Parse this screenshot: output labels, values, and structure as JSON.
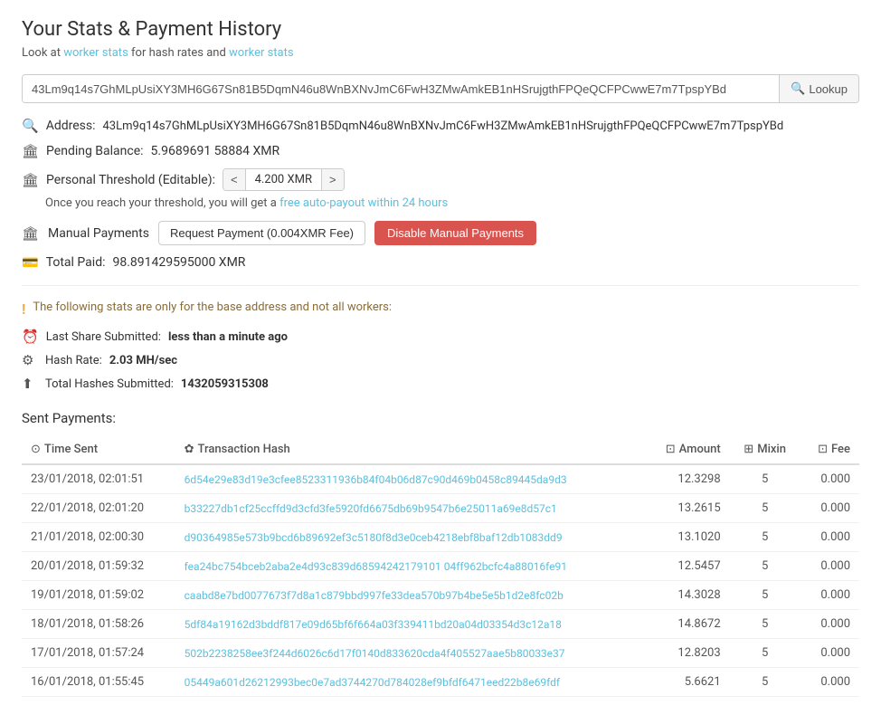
{
  "page": {
    "title": "Your Stats & Payment History",
    "subtitle_prefix": "Look at ",
    "subtitle_link1": "worker stats",
    "subtitle_middle": " for hash rates and ",
    "subtitle_link2": "worker stats"
  },
  "lookup": {
    "input_value": "43Lm9q14s7GhMLpUsiXY3MH6G67Sn81B5DqmN46u8WnBXNvJmC6FwH3ZMwAmkEB1nHSrujgthFPQeQCFPCwwE7m7TpspYBd",
    "button_label": "Lookup"
  },
  "address": {
    "label": "Address:",
    "value": "43Lm9q14s7GhMLpUsiXY3MH6G67Sn81B5DqmN46u8WnBXNvJmC6FwH3ZMwAmkEB1nHSrujgthFPQeQCFPCwwE7m7TpspYBd"
  },
  "pending_balance": {
    "label": "Pending Balance:",
    "value": "5.9689691 58884 XMR"
  },
  "threshold": {
    "label": "Personal Threshold (Editable):",
    "value": "4.200 XMR",
    "dec_btn": "<",
    "inc_btn": ">"
  },
  "auto_payout_note": "Once you reach your threshold, you will get a free auto-payout within 24 hours",
  "manual_payments": {
    "label": "Manual Payments",
    "request_btn": "Request Payment (0.004XMR Fee)",
    "disable_btn": "Disable Manual Payments"
  },
  "total_paid": {
    "label": "Total Paid:",
    "value": "98.891429595000 XMR"
  },
  "stats_note": "The following stats are only for the base address and not all workers:",
  "last_share": {
    "label": "Last Share Submitted:",
    "value": "less than a minute ago"
  },
  "hash_rate": {
    "label": "Hash Rate:",
    "value": "2.03 MH/sec"
  },
  "total_hashes": {
    "label": "Total Hashes Submitted:",
    "value": "1432059315308"
  },
  "payments_section": {
    "title": "Sent Payments:"
  },
  "table": {
    "headers": [
      {
        "icon": "⊙",
        "label": "Time Sent"
      },
      {
        "icon": "✿",
        "label": "Transaction Hash"
      },
      {
        "icon": "⊡",
        "label": "Amount"
      },
      {
        "icon": "⊞",
        "label": "Mixin"
      },
      {
        "icon": "⊡",
        "label": "Fee"
      }
    ],
    "rows": [
      {
        "time": "23/01/2018, 02:01:51",
        "hash": "6d54e29e83d19e3cfee8523311936b84f04b06d87c90d469b0458c89445da9d3",
        "amount": "12.3298",
        "mixin": "5",
        "fee": "0.000"
      },
      {
        "time": "22/01/2018, 02:01:20",
        "hash": "b33227db1cf25ccffd9d3cfd3fe5920fd6675db69b9547b6e25011a69e8d57c1",
        "amount": "13.2615",
        "mixin": "5",
        "fee": "0.000"
      },
      {
        "time": "21/01/2018, 02:00:30",
        "hash": "d90364985e573b9bcd6b89692ef3c5180f8d3e0ceb4218ebf8baf12db1083dd9",
        "amount": "13.1020",
        "mixin": "5",
        "fee": "0.000"
      },
      {
        "time": "20/01/2018, 01:59:32",
        "hash": "fea24bc754bceb2aba2e4d93c839d68594242179101 04ff962bcfc4a88016fe91",
        "amount": "12.5457",
        "mixin": "5",
        "fee": "0.000"
      },
      {
        "time": "19/01/2018, 01:59:02",
        "hash": "caabd8e7bd0077673f7d8a1c879bbd997fe33dea570b97b4be5e5b1d2e8fc02b",
        "amount": "14.3028",
        "mixin": "5",
        "fee": "0.000"
      },
      {
        "time": "18/01/2018, 01:58:26",
        "hash": "5df84a19162d3bddf817e09d65bf6f664a03f339411bd20a04d03354d3c12a18",
        "amount": "14.8672",
        "mixin": "5",
        "fee": "0.000"
      },
      {
        "time": "17/01/2018, 01:57:24",
        "hash": "502b2238258ee3f244d6026c6d17f0140d833620cda4f405527aae5b80033e37",
        "amount": "12.8203",
        "mixin": "5",
        "fee": "0.000"
      },
      {
        "time": "16/01/2018, 01:55:45",
        "hash": "05449a601d26212993bec0e7ad3744270d784028ef9bfdf6471eed22b8e69fdf",
        "amount": "5.6621",
        "mixin": "5",
        "fee": "0.000"
      }
    ]
  }
}
